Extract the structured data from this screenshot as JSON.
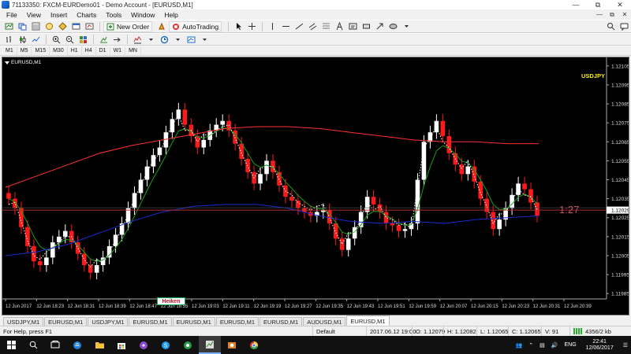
{
  "window": {
    "title": "71133350: FXCM-EURDemo01 - Demo Account - [EURUSD,M1]"
  },
  "menu": [
    "File",
    "View",
    "Insert",
    "Charts",
    "Tools",
    "Window",
    "Help"
  ],
  "toolbar": {
    "new_order": "New Order",
    "auto_trading": "AutoTrading"
  },
  "periods": [
    "M1",
    "M5",
    "M15",
    "M30",
    "H1",
    "H4",
    "D1",
    "W1",
    "MN"
  ],
  "chart": {
    "tag": "EURUSD,M1",
    "symbol_label": "USDJPY",
    "timer": "1:27",
    "heiken_label": "Heiken"
  },
  "chart_data": {
    "type": "candlestick",
    "symbol": "EURUSD,M1",
    "ylim": [
      1.11983,
      1.12107
    ],
    "y_ticks": [
      "1.12105",
      "1.12095",
      "1.12085",
      "1.12075",
      "1.12065",
      "1.12055",
      "1.12045",
      "1.12035",
      "1.12029",
      "1.12025",
      "1.12015",
      "1.12005",
      "1.11995",
      "1.11985"
    ],
    "x_ticks": [
      "12 Jun 2017",
      "12 Jun 18:23",
      "12 Jun 18:31",
      "12 Jun 18:39",
      "12 Jun 18:47",
      "12 Jun 18:55",
      "12 Jun 19:03",
      "12 Jun 19:11",
      "12 Jun 19:19",
      "12 Jun 19:27",
      "12 Jun 19:35",
      "12 Jun 19:43",
      "12 Jun 19:51",
      "12 Jun 19:59",
      "12 Jun 20:07",
      "12 Jun 20:15",
      "12 Jun 20:23",
      "12 Jun 20:31",
      "12 Jun 20:39"
    ],
    "current_price": 1.12029,
    "closes": [
      1.12035,
      1.1203,
      1.1202,
      1.1201,
      1.12002,
      1.12,
      1.12004,
      1.12012,
      1.12015,
      1.12018,
      1.12012,
      1.12006,
      1.12,
      1.11996,
      1.12,
      1.12004,
      1.1201,
      1.12016,
      1.12022,
      1.1203,
      1.12038,
      1.12045,
      1.12052,
      1.12058,
      1.12062,
      1.1207,
      1.12077,
      1.12082,
      1.12074,
      1.12068,
      1.12062,
      1.12066,
      1.12071,
      1.12074,
      1.12076,
      1.12071,
      1.12064,
      1.12056,
      1.12049,
      1.12043,
      1.12048,
      1.12055,
      1.12049,
      1.12042,
      1.12036,
      1.12034,
      1.1203,
      1.12028,
      1.12026,
      1.12028,
      1.12029,
      1.12022,
      1.12014,
      1.12008,
      1.12014,
      1.1202,
      1.12028,
      1.12036,
      1.12032,
      1.12028,
      1.12022,
      1.12021,
      1.12018,
      1.12019,
      1.12022,
      1.12045,
      1.12065,
      1.1207,
      1.12076,
      1.12068,
      1.12059,
      1.12053,
      1.12048,
      1.12052,
      1.12044,
      1.12035,
      1.12028,
      1.12019,
      1.12024,
      1.1203,
      1.12037,
      1.12043,
      1.1204,
      1.12033,
      1.12026
    ],
    "moving_averages": [
      {
        "color": "#ff3030",
        "values": [
          1.12041,
          1.12047,
          1.12053,
          1.12059,
          1.12063,
          1.12066,
          1.12069,
          1.12072,
          1.12073,
          1.12073,
          1.12072,
          1.1207,
          1.12068,
          1.12066,
          1.12065,
          1.12065,
          1.12064,
          1.12064
        ]
      },
      {
        "color": "#1a2ccc",
        "values": [
          1.12005,
          1.12007,
          1.12011,
          1.12017,
          1.12023,
          1.12028,
          1.12031,
          1.12032,
          1.12032,
          1.1203,
          1.12026,
          1.12023,
          1.12022,
          1.12023,
          1.12022,
          1.12024,
          1.12025,
          1.12026
        ]
      }
    ]
  },
  "tabs": [
    "USDJPY,M1",
    "EURUSD,M1",
    "USDJPY,M1",
    "EURUSD,M1",
    "EURUSD,M1",
    "EURUSD,M1",
    "EURUSD,M1",
    "AUDUSD,M1",
    "EURUSD,M1"
  ],
  "active_tab": 8,
  "status": {
    "help": "For Help, press F1",
    "profile": "Default",
    "datetime": "2017.06.12 19:00",
    "open": "O: 1.12079",
    "high": "H: 1.12082",
    "low": "L: 1.12065",
    "close": "C: 1.12065",
    "volume": "V: 91",
    "traffic": "4356/2 kb"
  },
  "taskbar": {
    "lang": "ENG",
    "time": "22:41",
    "date": "12/06/2017"
  }
}
